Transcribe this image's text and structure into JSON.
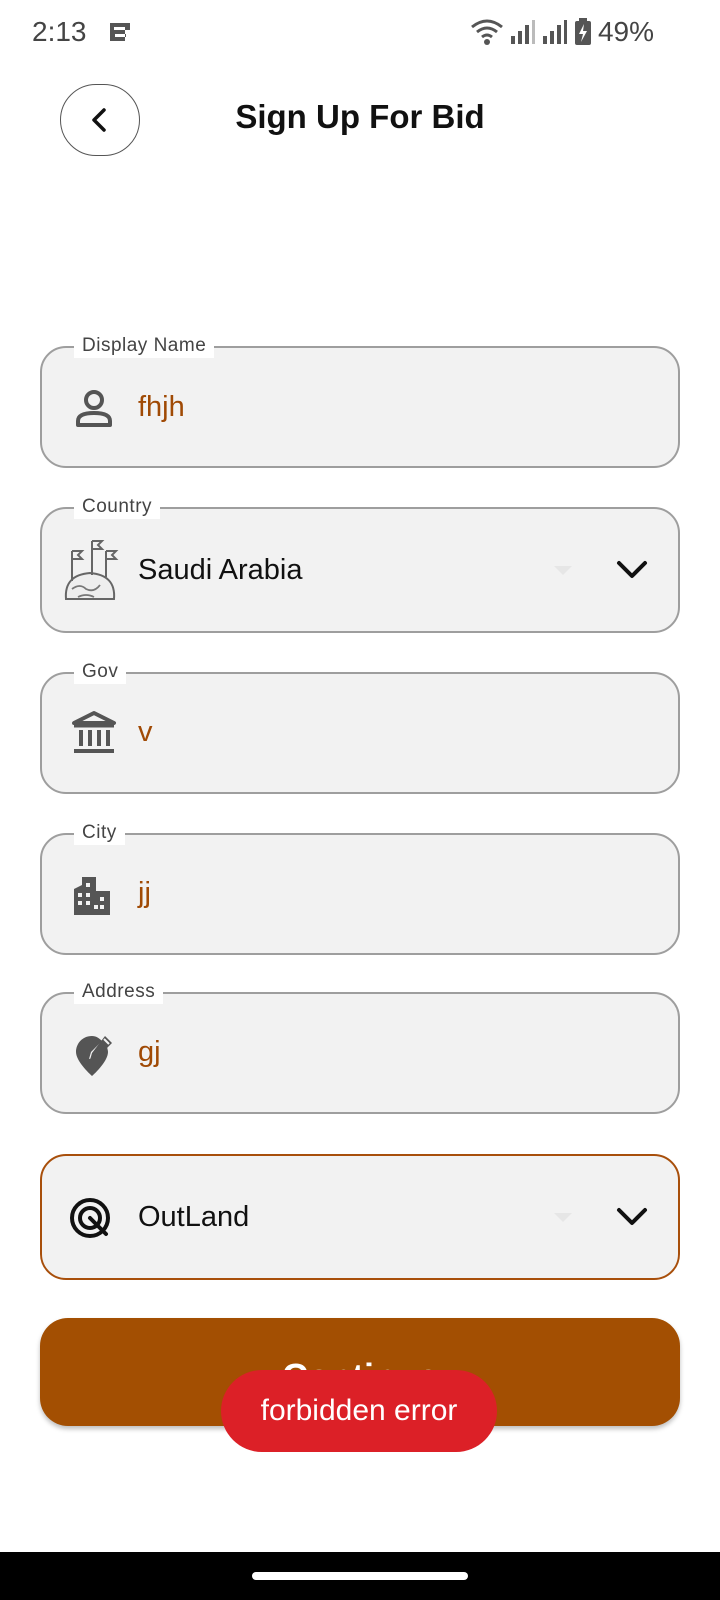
{
  "status": {
    "time": "2:13",
    "battery": "49%"
  },
  "header": {
    "title": "Sign Up For Bid"
  },
  "form": {
    "display_name": {
      "label": "Display Name",
      "value": "fhjh"
    },
    "country": {
      "label": "Country",
      "value": "Saudi Arabia"
    },
    "gov": {
      "label": "Gov",
      "value": "v"
    },
    "city": {
      "label": "City",
      "value": "jj"
    },
    "address": {
      "label": "Address",
      "value": "gj"
    },
    "location_type": {
      "value": "OutLand"
    }
  },
  "actions": {
    "continue_label": "Continue"
  },
  "toast": {
    "message": "forbidden error"
  },
  "colors": {
    "accent": "#a34f02",
    "typed_text": "#a04a05",
    "toast": "#dc2027",
    "field_bg": "#f2f2f2"
  },
  "icons": [
    "back-icon",
    "person-icon",
    "globe-flags-icon",
    "bank-icon",
    "buildings-icon",
    "location-edit-icon",
    "target-icon",
    "chevron-down-icon"
  ]
}
